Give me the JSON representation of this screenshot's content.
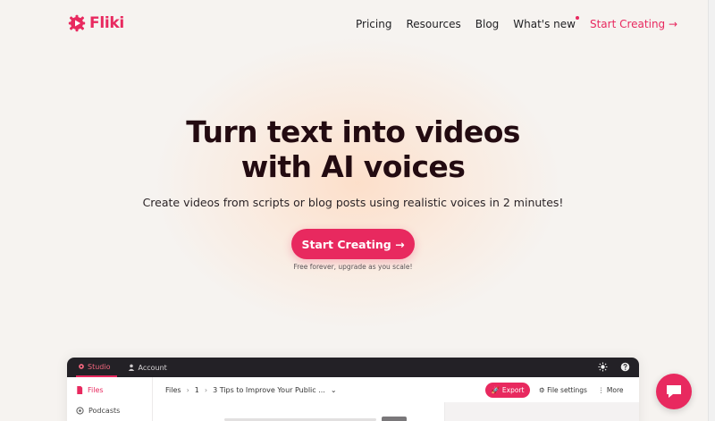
{
  "brand": {
    "name": "Fliki",
    "accent": "#e8295f",
    "logo_icon": "gear-play-icon"
  },
  "nav": {
    "items": [
      "Pricing",
      "Resources",
      "Blog",
      "What's new"
    ],
    "cta": "Start Creating →"
  },
  "hero": {
    "headline_line1": "Turn text into videos",
    "headline_line2": "with AI voices",
    "subtitle": "Create videos from scripts or blog posts using realistic voices in 2 minutes!",
    "cta": "Start Creating →",
    "note": "Free forever, upgrade as you scale!"
  },
  "app": {
    "tabs": [
      {
        "label": "Studio",
        "icon": "gear-icon",
        "active": true
      },
      {
        "label": "Account",
        "icon": "user-icon",
        "active": false
      }
    ],
    "sidebar": [
      {
        "label": "Files",
        "icon": "file-icon",
        "active": true
      },
      {
        "label": "Podcasts",
        "icon": "podcast-icon",
        "active": false
      }
    ],
    "breadcrumb": [
      "Files",
      "1",
      "3 Tips to Improve Your Public ..."
    ],
    "export_label": "Export",
    "file_settings_label": "File settings",
    "more_label": "More",
    "top_icons": [
      "sun-icon",
      "help-icon"
    ]
  },
  "chat": {
    "icon": "chat-icon"
  }
}
